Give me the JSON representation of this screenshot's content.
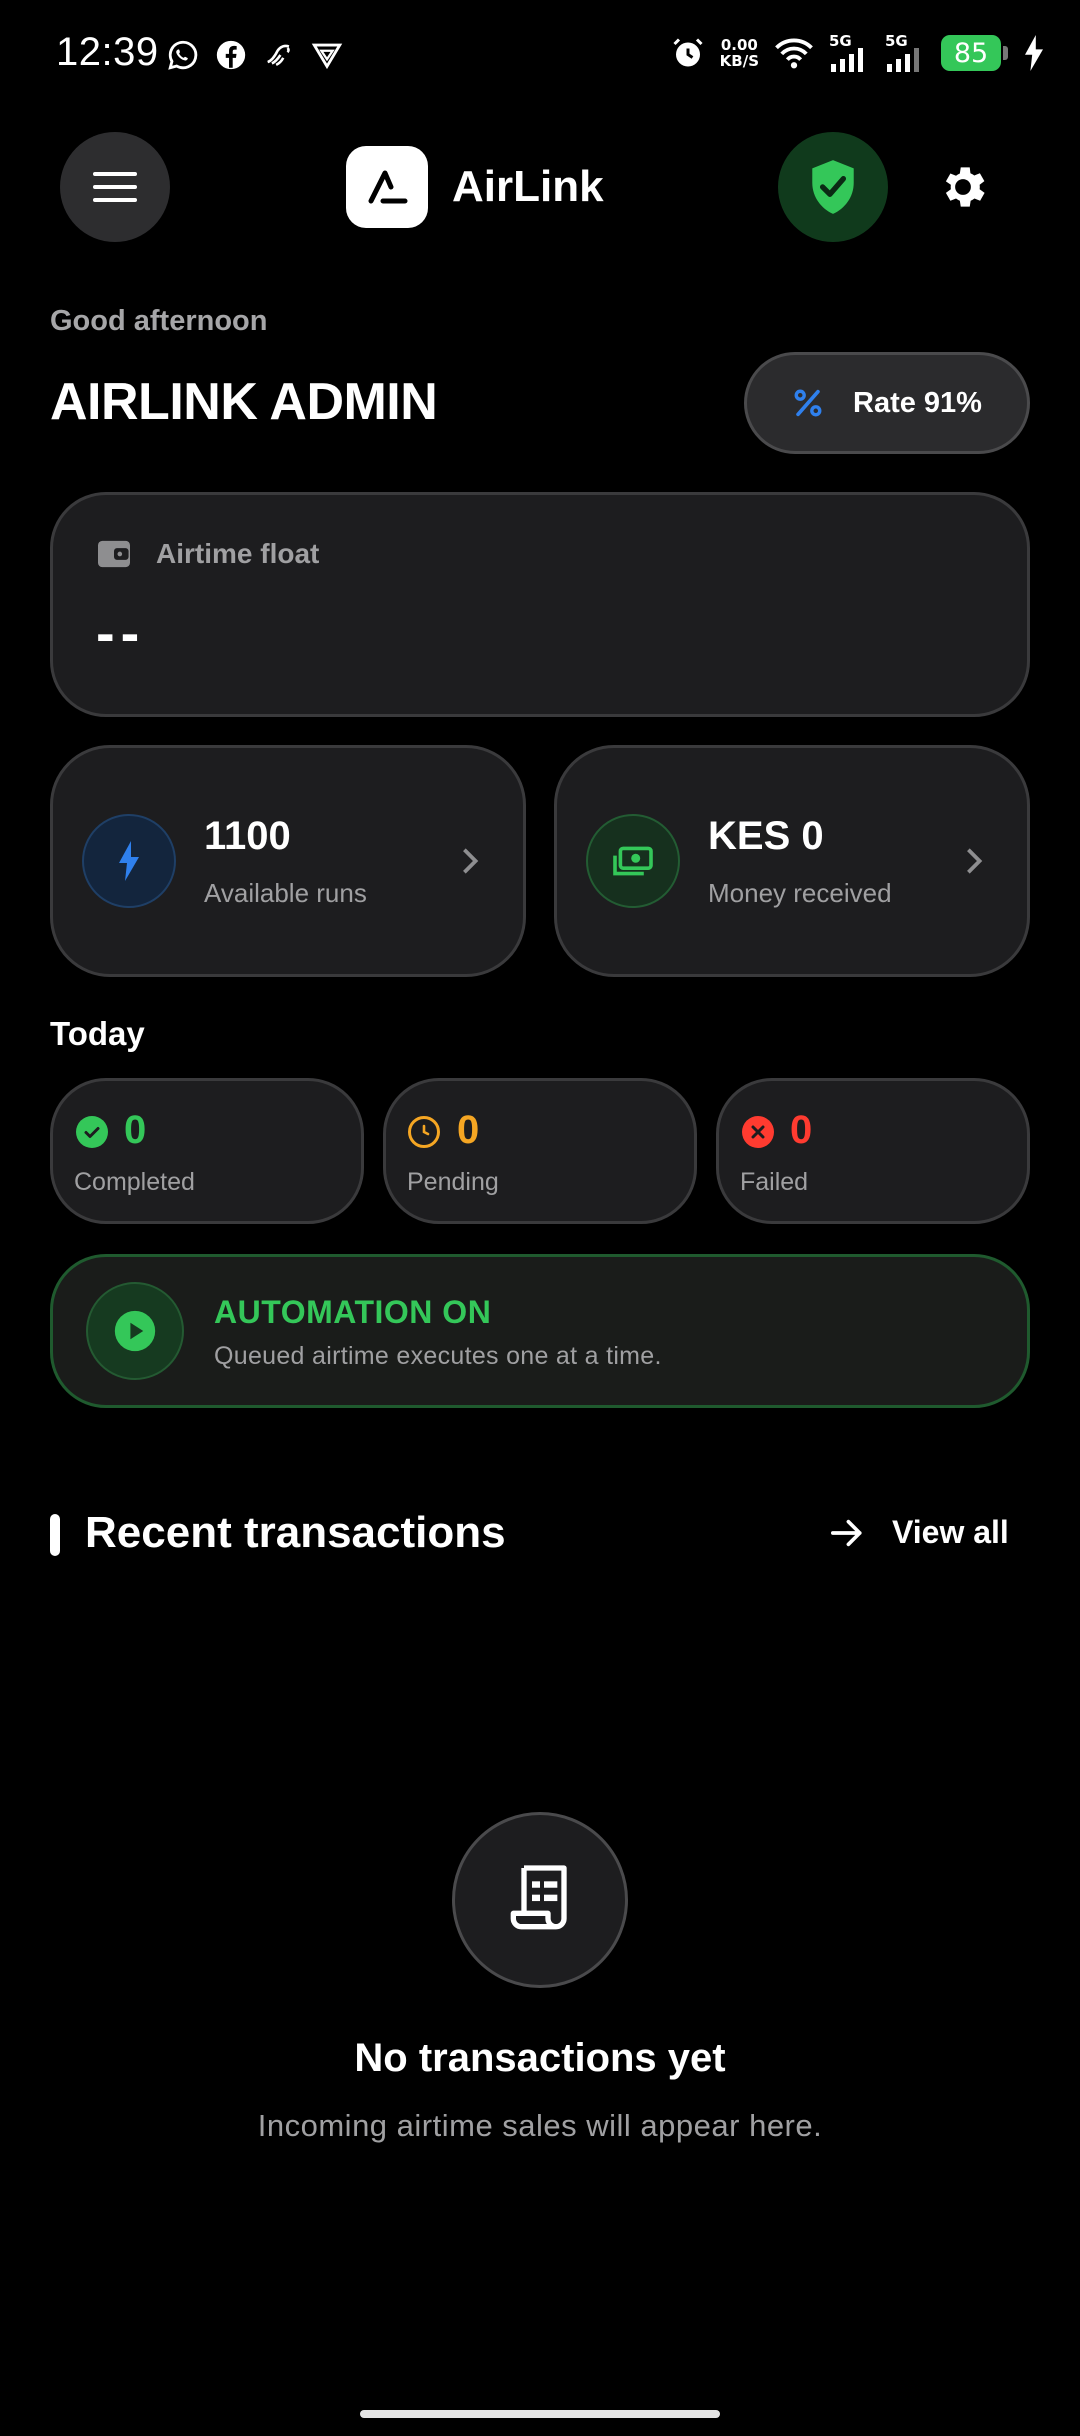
{
  "status_bar": {
    "time": "12:39",
    "net_speed_value": "0.00",
    "net_speed_unit": "KB/S",
    "signal1_label": "5G",
    "signal2_label": "5G",
    "battery": "85",
    "icons": [
      "whatsapp-icon",
      "facebook-icon",
      "notification-icon",
      "vpn-icon",
      "alarm-icon",
      "wifi-icon",
      "signal-icon",
      "signal-icon",
      "battery-icon",
      "charging-icon"
    ]
  },
  "header": {
    "app_name": "AirLink",
    "shield_color": "#34c759"
  },
  "greeting": {
    "salutation": "Good afternoon",
    "username": "AIRLINK ADMIN",
    "rate_label": "Rate 91%"
  },
  "float_card": {
    "label": "Airtime float",
    "value": "--"
  },
  "stats": {
    "runs": {
      "value": "1100",
      "label": "Available runs",
      "color": "#2f80ed"
    },
    "money": {
      "value": "KES 0",
      "label": "Money received",
      "color": "#34c759"
    }
  },
  "today": {
    "title": "Today",
    "completed": {
      "value": "0",
      "label": "Completed",
      "color": "#34c759"
    },
    "pending": {
      "value": "0",
      "label": "Pending",
      "color": "#f5a623"
    },
    "failed": {
      "value": "0",
      "label": "Failed",
      "color": "#ff3b30"
    }
  },
  "automation": {
    "title": "AUTOMATION ON",
    "subtitle": "Queued airtime executes one at a time."
  },
  "recent": {
    "title": "Recent transactions",
    "view_all": "View all",
    "empty_title": "No transactions yet",
    "empty_subtitle": "Incoming airtime sales will appear here."
  }
}
